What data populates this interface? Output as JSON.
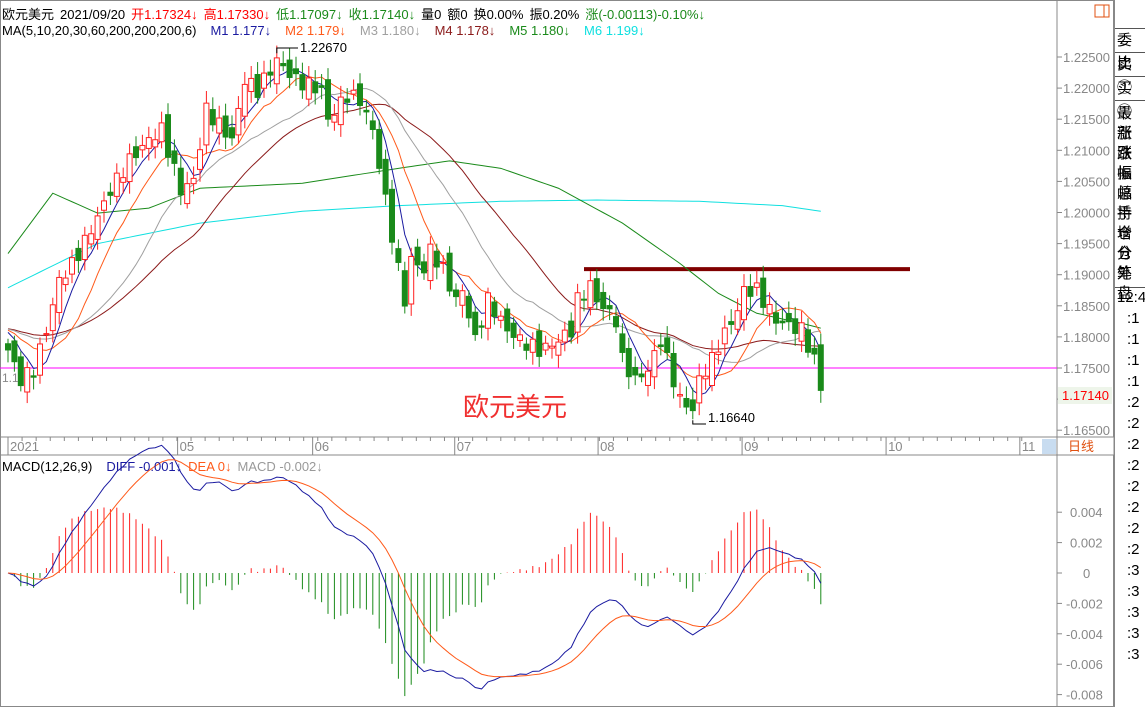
{
  "header": {
    "name": "欧元美元",
    "date": "2021/09/20",
    "open": "开1.17324↓",
    "high": "高1.17330↓",
    "low": "低1.17097↓",
    "close": "收1.17140↓",
    "volume": "量0",
    "amount": "额0",
    "turnover": "换0.00%",
    "amplitude": "振0.20%",
    "change": "涨(-0.00113)-0.10%↓"
  },
  "ma_header": {
    "label": "MA(5,10,20,30,60,200,200,200,6)",
    "items": [
      {
        "name": "M1",
        "value": "1.177↓",
        "color": "#1a1aa0"
      },
      {
        "name": "M2",
        "value": "1.179↓",
        "color": "#ff5a1a"
      },
      {
        "name": "M3",
        "value": "1.180↓",
        "color": "#a0a0a0"
      },
      {
        "name": "M4",
        "value": "1.178↓",
        "color": "#8b1a1a"
      },
      {
        "name": "M5",
        "value": "1.180↓",
        "color": "#1a8a1a"
      },
      {
        "name": "M6",
        "value": "1.199↓",
        "color": "#10e0e0"
      }
    ]
  },
  "macd_header": {
    "label": "MACD(12,26,9)",
    "diff": "DIFF -0.001↓",
    "dea": "DEA 0↓",
    "macd": "MACD -0.002↓"
  },
  "colors": {
    "up": "#ff2020",
    "down": "#1a8a1a",
    "resistance": "#800000",
    "support": "#ff00ff"
  },
  "chart_data": {
    "type": "candlestick",
    "title": "欧元美元",
    "annotation": "欧元美元",
    "high_label": "1.22670",
    "low_label": "1.16640",
    "last_price": "1.17140",
    "left_cut_label": "1.1",
    "period_label": "日线",
    "ylim": [
      1.1635,
      1.2295
    ],
    "y_ticks": [
      "1.22500",
      "1.22000",
      "1.21500",
      "1.21000",
      "1.20500",
      "1.20000",
      "1.19500",
      "1.19000",
      "1.18500",
      "1.18000",
      "1.17500",
      "1.17000",
      "1.16500"
    ],
    "x_ticks": [
      {
        "label": "2021",
        "day": 0
      },
      {
        "label": "05",
        "day": 26.5
      },
      {
        "label": "06",
        "day": 47.6
      },
      {
        "label": "07",
        "day": 69.8
      },
      {
        "label": "08",
        "day": 92.2
      },
      {
        "label": "09",
        "day": 114.7
      },
      {
        "label": "10",
        "day": 137.2
      },
      {
        "label": "11",
        "day": 158.1
      }
    ],
    "n_days": 128,
    "close_anchors": [
      [
        0,
        1.1779
      ],
      [
        2,
        1.1731
      ],
      [
        4,
        1.1747
      ],
      [
        6,
        1.1811
      ],
      [
        8,
        1.1891
      ],
      [
        10,
        1.1916
      ],
      [
        13,
        1.1972
      ],
      [
        16,
        1.2036
      ],
      [
        19,
        1.2084
      ],
      [
        22,
        1.2117
      ],
      [
        24,
        1.2133
      ],
      [
        27,
        1.2036
      ],
      [
        29,
        1.2052
      ],
      [
        31,
        1.2165
      ],
      [
        35,
        1.2117
      ],
      [
        37,
        1.2213
      ],
      [
        39,
        1.2197
      ],
      [
        42,
        1.2245
      ],
      [
        45,
        1.2213
      ],
      [
        49,
        1.2197
      ],
      [
        50,
        1.2149
      ],
      [
        53,
        1.2189
      ],
      [
        55,
        1.2181
      ],
      [
        57,
        1.2133
      ],
      [
        59,
        1.202
      ],
      [
        61,
        1.1908
      ],
      [
        62,
        1.1859
      ],
      [
        63,
        1.1924
      ],
      [
        65,
        1.1908
      ],
      [
        66,
        1.194
      ],
      [
        68,
        1.1908
      ],
      [
        70,
        1.1859
      ],
      [
        71,
        1.1875
      ],
      [
        73,
        1.1795
      ],
      [
        75,
        1.1859
      ],
      [
        78,
        1.1811
      ],
      [
        80,
        1.1795
      ],
      [
        83,
        1.1779
      ],
      [
        85,
        1.1787
      ],
      [
        88,
        1.1811
      ],
      [
        89,
        1.1859
      ],
      [
        91,
        1.1883
      ],
      [
        92,
        1.1859
      ],
      [
        95,
        1.1827
      ],
      [
        96,
        1.1763
      ],
      [
        98,
        1.1731
      ],
      [
        100,
        1.1747
      ],
      [
        102,
        1.1795
      ],
      [
        103,
        1.1763
      ],
      [
        105,
        1.1699
      ],
      [
        107,
        1.1683
      ],
      [
        108,
        1.1731
      ],
      [
        110,
        1.1763
      ],
      [
        111,
        1.1787
      ],
      [
        114,
        1.1843
      ],
      [
        115,
        1.1875
      ],
      [
        117,
        1.1875
      ],
      [
        118,
        1.1859
      ],
      [
        120,
        1.1827
      ],
      [
        122,
        1.1819
      ],
      [
        124,
        1.1811
      ],
      [
        126,
        1.1763
      ],
      [
        127,
        1.1714
      ]
    ],
    "ma60_anchors": [
      [
        0,
        1.1934
      ],
      [
        7,
        1.2031
      ],
      [
        14,
        1.1999
      ],
      [
        22,
        1.2007
      ],
      [
        30,
        1.2039
      ],
      [
        46,
        1.2047
      ],
      [
        61,
        1.2071
      ],
      [
        69,
        1.2083
      ],
      [
        77,
        1.2071
      ],
      [
        86,
        1.2039
      ],
      [
        96,
        1.1983
      ],
      [
        105,
        1.1918
      ],
      [
        111,
        1.187
      ],
      [
        117,
        1.1838
      ],
      [
        124,
        1.1822
      ],
      [
        127,
        1.1814
      ]
    ],
    "ma200_anchors": [
      [
        0,
        1.1879
      ],
      [
        14,
        1.195
      ],
      [
        30,
        1.1983
      ],
      [
        46,
        1.2002
      ],
      [
        61,
        1.2011
      ],
      [
        77,
        1.2018
      ],
      [
        92,
        1.202
      ],
      [
        108,
        1.2018
      ],
      [
        121,
        1.2011
      ],
      [
        127,
        1.2002
      ]
    ],
    "resistance": {
      "price": 1.1909,
      "from_day": 90,
      "to_day": 140
    },
    "support": {
      "price": 1.175
    },
    "macd": {
      "ylim": [
        -0.0085,
        0.0055
      ],
      "y_ticks": [
        "0.004",
        "0.002",
        "0",
        "-0.002",
        "-0.004",
        "-0.006",
        "-0.008"
      ],
      "y_values": [
        0.004,
        0.002,
        0,
        -0.002,
        -0.004,
        -0.006,
        -0.008
      ]
    }
  },
  "right_panel": {
    "rows": [
      "委比",
      "卖①",
      "买①"
    ],
    "fields": [
      "最新",
      "涨跌",
      "涨幅",
      "振幅",
      "总手",
      "持仓",
      "增仓",
      "分笔",
      "外盘"
    ],
    "time": "12:4",
    "ticks": [
      ":1",
      ":1",
      ":1",
      ":1",
      ":2",
      ":2",
      ":2",
      ":2",
      ":2",
      ":2",
      ":2",
      ":2",
      ":3",
      ":3",
      ":3",
      ":3",
      ":3"
    ]
  }
}
